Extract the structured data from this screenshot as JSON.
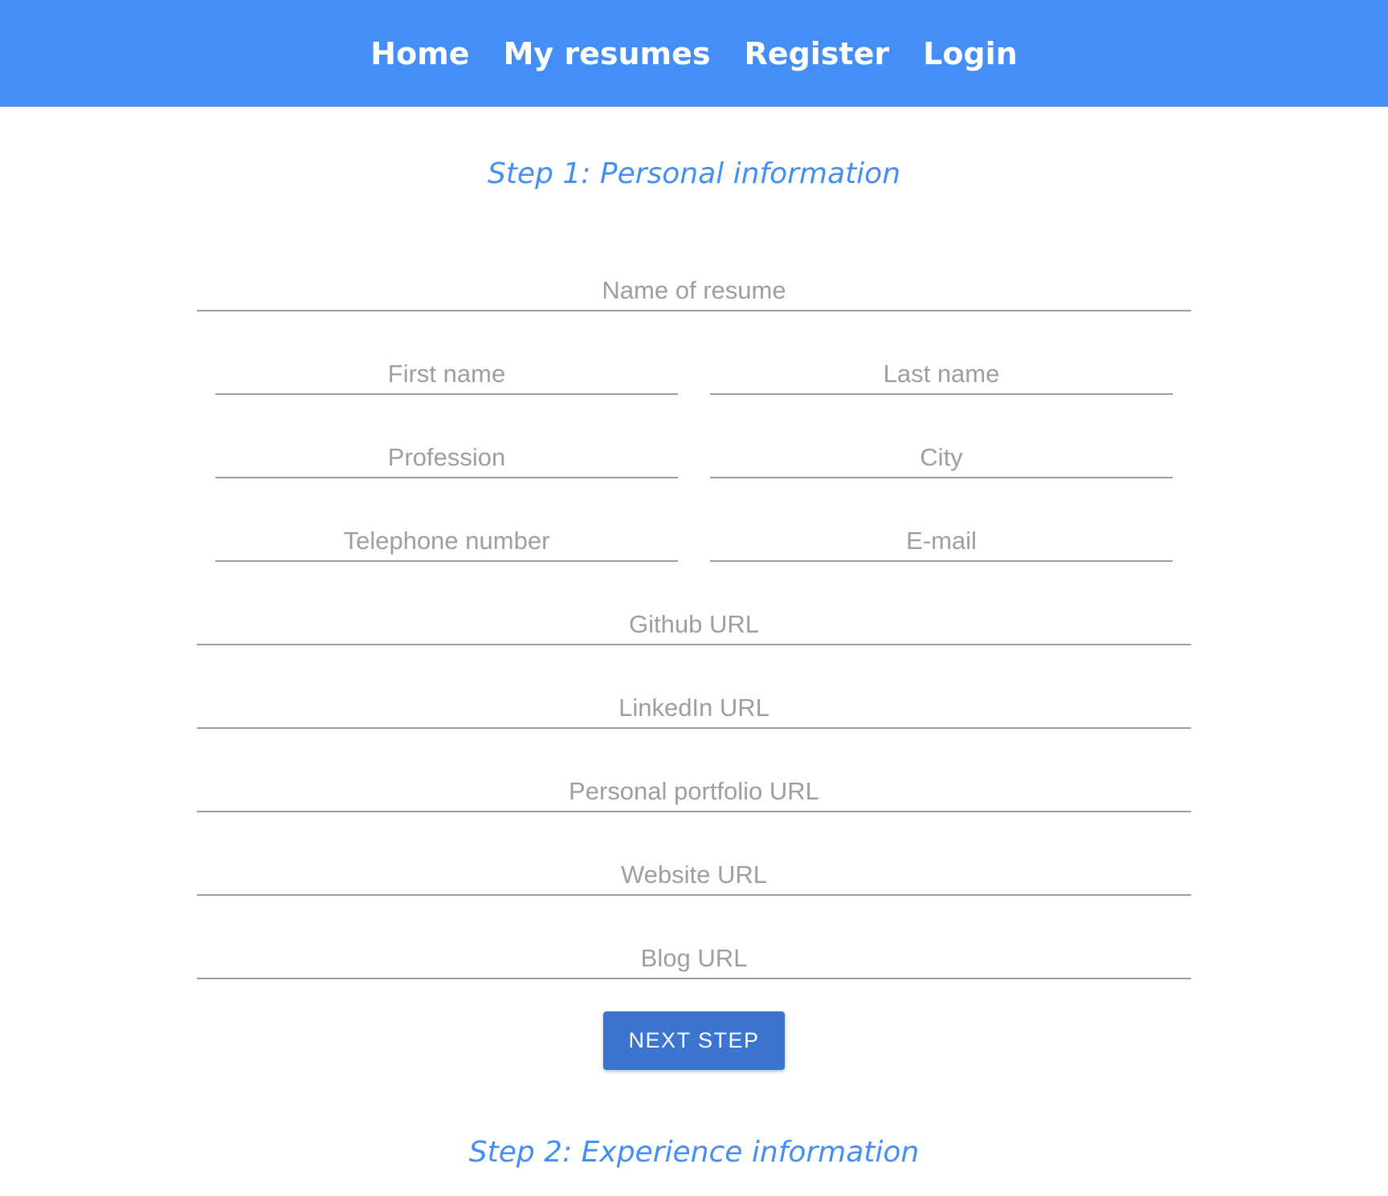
{
  "nav": {
    "items": [
      {
        "label": "Home"
      },
      {
        "label": "My resumes"
      },
      {
        "label": "Register"
      },
      {
        "label": "Login"
      }
    ]
  },
  "step1": {
    "title": "Step 1: Personal information"
  },
  "form": {
    "resume_name": {
      "placeholder": "Name of resume",
      "value": ""
    },
    "first_name": {
      "placeholder": "First name",
      "value": ""
    },
    "last_name": {
      "placeholder": "Last name",
      "value": ""
    },
    "profession": {
      "placeholder": "Profession",
      "value": ""
    },
    "city": {
      "placeholder": "City",
      "value": ""
    },
    "telephone": {
      "placeholder": "Telephone number",
      "value": ""
    },
    "email": {
      "placeholder": "E-mail",
      "value": ""
    },
    "github": {
      "placeholder": "Github URL",
      "value": ""
    },
    "linkedin": {
      "placeholder": "LinkedIn URL",
      "value": ""
    },
    "portfolio": {
      "placeholder": "Personal portfolio URL",
      "value": ""
    },
    "website": {
      "placeholder": "Website URL",
      "value": ""
    },
    "blog": {
      "placeholder": "Blog URL",
      "value": ""
    },
    "next_label": "NEXT STEP"
  },
  "step2": {
    "title": "Step 2: Experience information"
  },
  "colors": {
    "brand": "#448ef6",
    "button": "#3b75cf",
    "placeholder": "#9e9e9e"
  }
}
